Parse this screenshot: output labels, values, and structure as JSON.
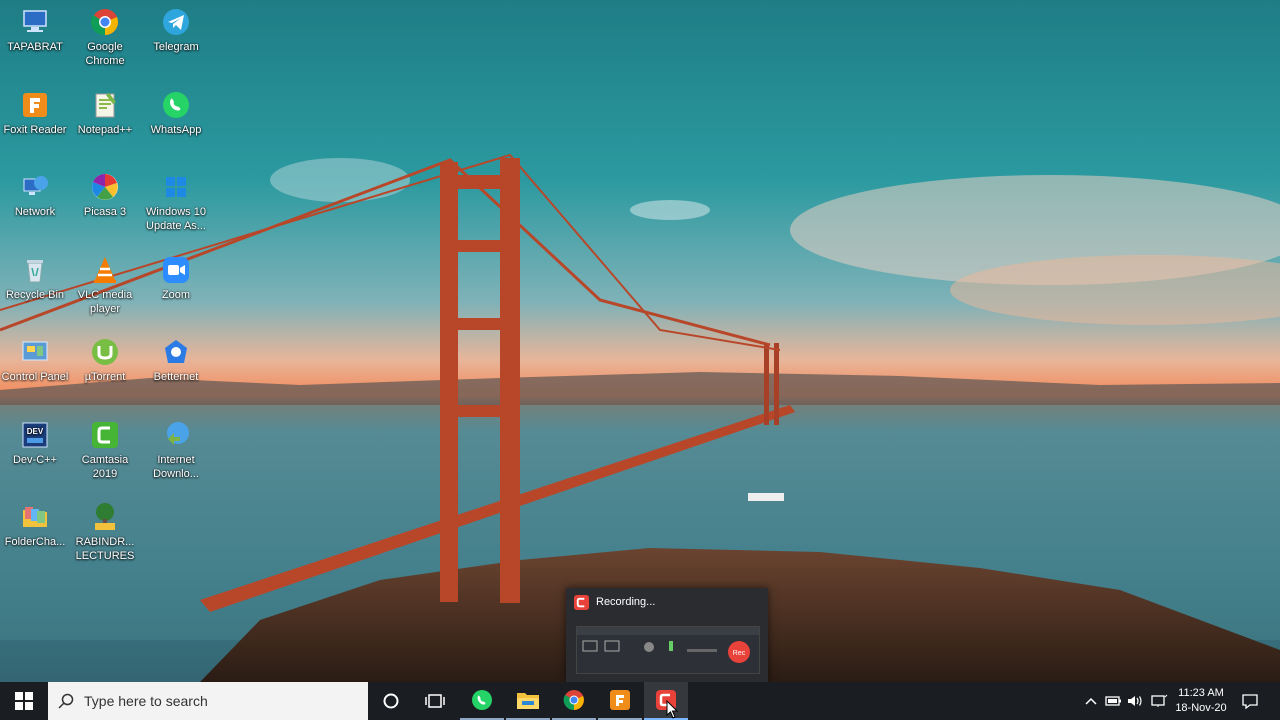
{
  "desktop": {
    "icons": [
      {
        "label": "TAPABRAT",
        "icon": "computer-icon"
      },
      {
        "label": "Google Chrome",
        "icon": "chrome-icon"
      },
      {
        "label": "Telegram",
        "icon": "telegram-icon"
      },
      {
        "label": "Foxit Reader",
        "icon": "foxit-icon"
      },
      {
        "label": "Notepad++",
        "icon": "notepad-plus-plus-icon"
      },
      {
        "label": "WhatsApp",
        "icon": "whatsapp-icon"
      },
      {
        "label": "Network",
        "icon": "network-icon"
      },
      {
        "label": "Picasa 3",
        "icon": "picasa-icon"
      },
      {
        "label": "Windows 10 Update As...",
        "icon": "windows-update-icon"
      },
      {
        "label": "Recycle Bin",
        "icon": "recycle-bin-icon"
      },
      {
        "label": "VLC media player",
        "icon": "vlc-icon"
      },
      {
        "label": "Zoom",
        "icon": "zoom-icon"
      },
      {
        "label": "Control Panel",
        "icon": "control-panel-icon"
      },
      {
        "label": "µTorrent",
        "icon": "utorrent-icon"
      },
      {
        "label": "Betternet",
        "icon": "betternet-icon"
      },
      {
        "label": "Dev-C++",
        "icon": "dev-cpp-icon"
      },
      {
        "label": "Camtasia 2019",
        "icon": "camtasia-icon"
      },
      {
        "label": "Internet Downlo...",
        "icon": "internet-download-manager-icon"
      },
      {
        "label": "FolderCha...",
        "icon": "folder-changer-icon"
      },
      {
        "label": "RABINDR... LECTURES",
        "icon": "tree-folder-icon"
      }
    ]
  },
  "recording_popup": {
    "title": "Recording...",
    "thumb_rec_label": "Rec"
  },
  "taskbar": {
    "search_placeholder": "Type here to search",
    "apps": [
      {
        "name": "cortana-button",
        "icon": "cortana-icon"
      },
      {
        "name": "task-view-button",
        "icon": "task-view-icon"
      },
      {
        "name": "taskbar-whatsapp",
        "icon": "whatsapp-icon"
      },
      {
        "name": "taskbar-file-explorer",
        "icon": "file-explorer-icon"
      },
      {
        "name": "taskbar-chrome",
        "icon": "chrome-icon"
      },
      {
        "name": "taskbar-foxit",
        "icon": "foxit-icon"
      },
      {
        "name": "taskbar-camtasia-recorder",
        "icon": "camtasia-recorder-icon"
      }
    ],
    "clock": {
      "time": "11:23 AM",
      "date": "18-Nov-20"
    }
  },
  "colors": {
    "taskbar_bg": "#1a1d22",
    "accent": "#7ab7ff",
    "sky": "#2a8f95",
    "bridge": "#b8472a"
  }
}
